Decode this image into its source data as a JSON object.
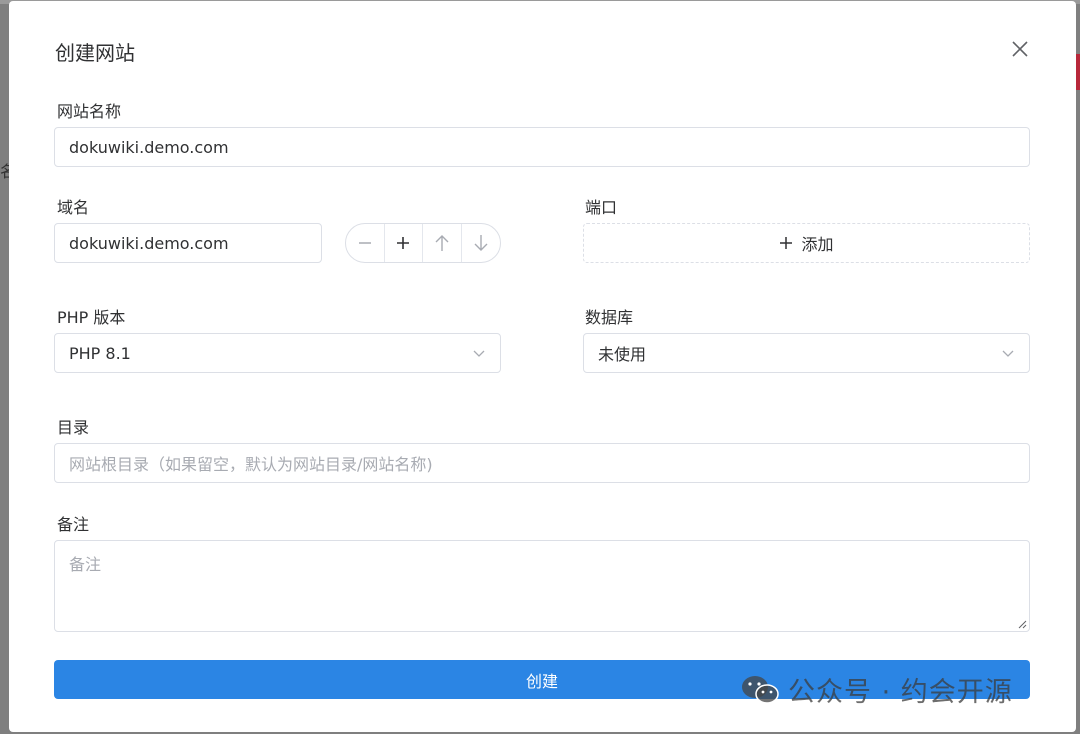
{
  "dialog": {
    "title": "创建网站",
    "close_icon": "close-icon"
  },
  "site_name": {
    "label": "网站名称",
    "value": "dokuwiki.demo.com"
  },
  "domain": {
    "label": "域名",
    "value": "dokuwiki.demo.com",
    "stepper_icons": [
      "minus-icon",
      "plus-icon",
      "arrow-up-icon",
      "arrow-down-icon"
    ]
  },
  "port": {
    "label": "端口",
    "add_label": "添加"
  },
  "php": {
    "label": "PHP 版本",
    "selected": "PHP 8.1"
  },
  "database": {
    "label": "数据库",
    "selected": "未使用"
  },
  "directory": {
    "label": "目录",
    "placeholder": "网站根目录（如果留空，默认为网站目录/网站名称)"
  },
  "remark": {
    "label": "备注",
    "placeholder": "备注"
  },
  "submit": {
    "label": "创建",
    "color": "#2b85e4"
  },
  "watermark": {
    "text": "公众号 · 约会开源",
    "icon": "wechat-icon"
  },
  "background": {
    "partial_char": "名"
  }
}
